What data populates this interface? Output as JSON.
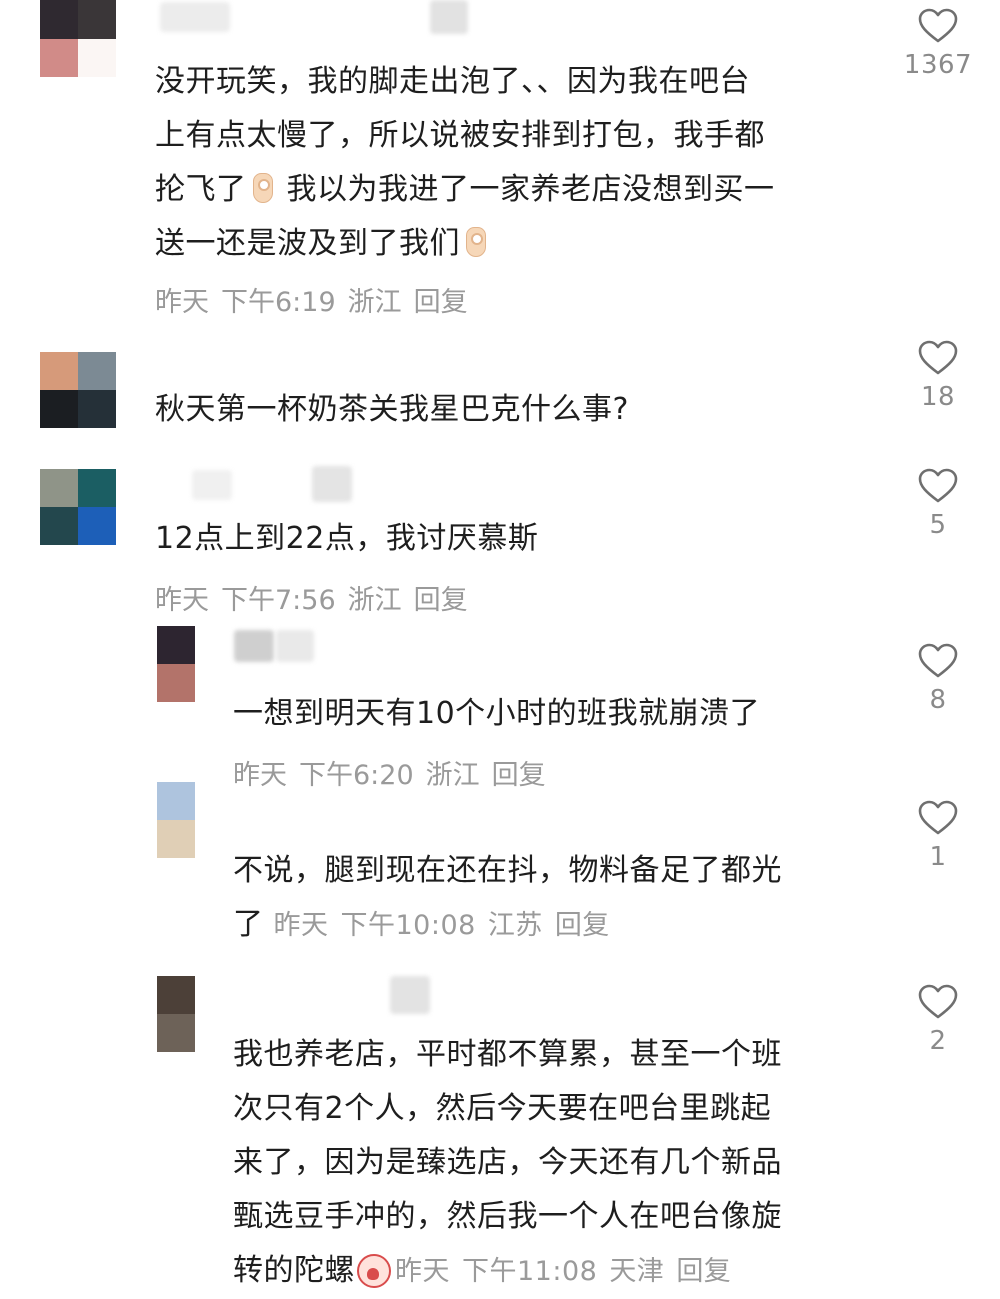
{
  "comments": [
    {
      "avatar_colors": [
        "#2f2930",
        "#3a3638",
        "#d18b88",
        "#fbf6f4"
      ],
      "text": "没开玩笑，我的脚走出泡了、、因为我在吧台\n上有点太慢了，所以说被安排到打包，我手都\n抡飞了",
      "text_b": "我以为我进了一家养老店没想到买一\n送一还是波及到了我们",
      "date": "昨天",
      "time": "下午6:19",
      "location": "浙江",
      "reply": "回复",
      "likes": "1367"
    },
    {
      "avatar_colors": [
        "#d69a7a",
        "#7c8a94",
        "#1b1e22",
        "#253038"
      ],
      "text": "秋天第一杯奶茶关我星巴克什么事?",
      "likes": "18"
    },
    {
      "avatar_colors": [
        "#8f9488",
        "#1b5e63",
        "#23474d",
        "#1d5fb8"
      ],
      "text": "12点上到22点，我讨厌慕斯",
      "date": "昨天",
      "time": "下午7:56",
      "location": "浙江",
      "reply": "回复",
      "likes": "5"
    },
    {
      "avatar_colors": [
        "#2d2530",
        "#b3736a"
      ],
      "text": "一想到明天有10个小时的班我就崩溃了",
      "date": "昨天",
      "time": "下午6:20",
      "location": "浙江",
      "reply": "回复",
      "likes": "8"
    },
    {
      "avatar_colors": [
        "#aec4de",
        "#e0cfb6"
      ],
      "text": "不说，腿到现在还在抖，物料备足了都光\n了",
      "date": "昨天",
      "time": "下午10:08",
      "location": "江苏",
      "reply": "回复",
      "likes": "1"
    },
    {
      "avatar_colors": [
        "#4c4038",
        "#6d6258"
      ],
      "text": "我也养老店，平时都不算累，甚至一个班\n次只有2个人，然后今天要在吧台里跳起\n来了，因为是臻选店，今天还有几个新品\n甄选豆手冲的，然后我一个人在吧台像旋\n转的陀螺",
      "date": "昨天",
      "time": "下午11:08",
      "location": "天津",
      "reply": "回复",
      "likes": "2"
    }
  ],
  "icons": {
    "like": "heart-outline-icon",
    "emoji_ok": "ok-hand-emoji-icon",
    "emoji_cry": "crying-face-emoji-icon"
  },
  "colors": {
    "meta_text": "#9a9a9a",
    "like_count": "#8a8a8a",
    "body_text": "#1e1e1e"
  }
}
